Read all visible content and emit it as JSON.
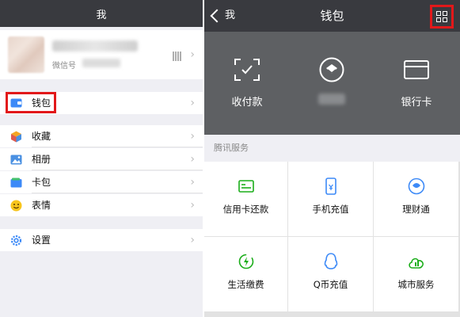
{
  "left": {
    "header_title": "我",
    "profile": {
      "wechat_id_label": "微信号"
    },
    "menu": {
      "wallet": "钱包",
      "favorites": "收藏",
      "album": "相册",
      "cards": "卡包",
      "stickers": "表情",
      "settings": "设置"
    },
    "chevron": "›"
  },
  "right": {
    "header": {
      "back_label": "我",
      "title": "钱包"
    },
    "banner": {
      "pay": "收付款",
      "cards": "银行卡"
    },
    "services_header": "腾讯服务",
    "services": [
      {
        "label": "信用卡还款",
        "icon": "credit-card-icon"
      },
      {
        "label": "手机充值",
        "icon": "phone-icon"
      },
      {
        "label": "理财通",
        "icon": "finance-icon"
      },
      {
        "label": "生活缴费",
        "icon": "lightning-icon"
      },
      {
        "label": "Q币充值",
        "icon": "qq-penguin-icon"
      },
      {
        "label": "城市服务",
        "icon": "city-service-icon"
      }
    ]
  },
  "colors": {
    "header_bg": "#393a3f",
    "banner_bg": "#5e6063",
    "accent_green": "#1aad19",
    "highlight_red": "#e2181a",
    "page_bg": "#efeff4"
  }
}
